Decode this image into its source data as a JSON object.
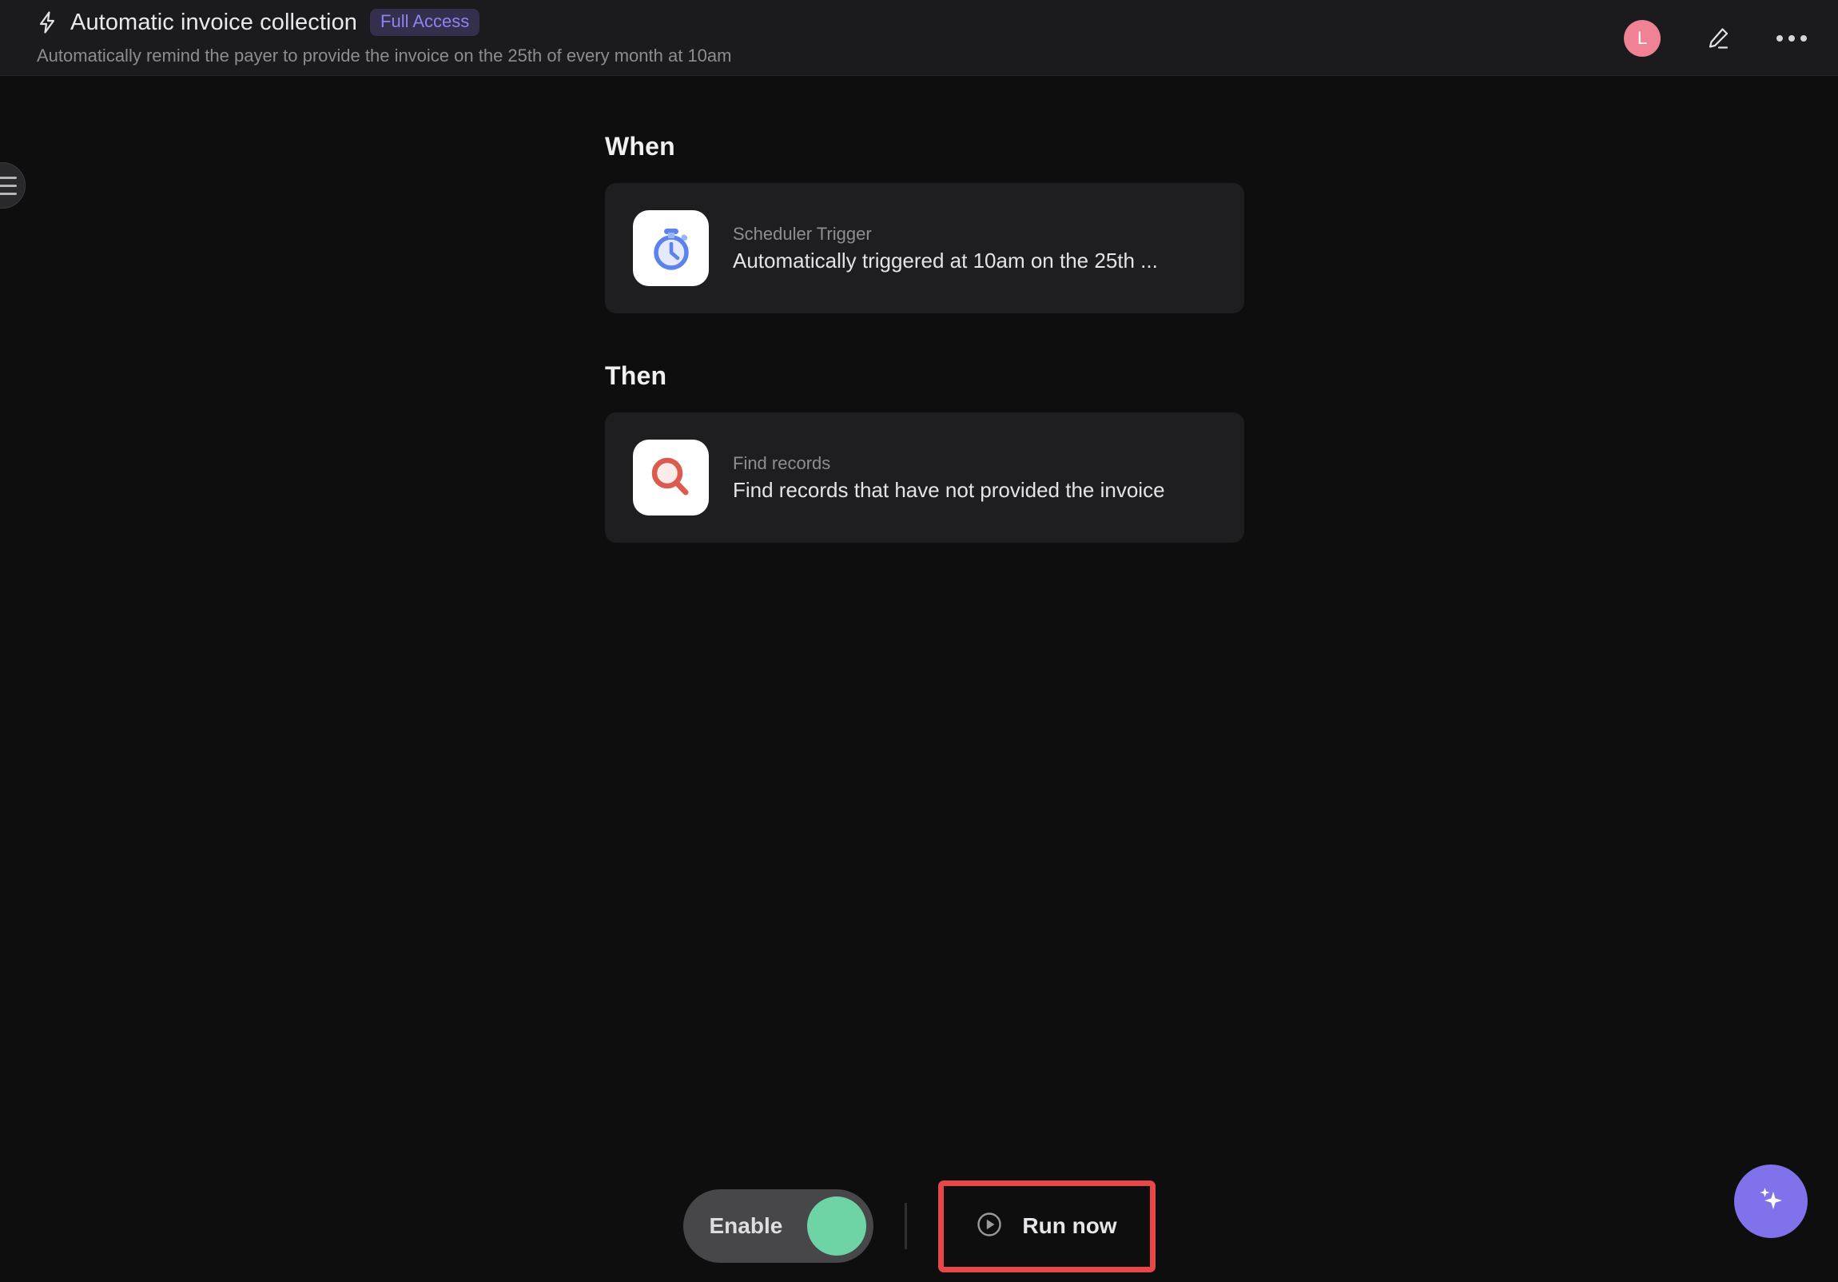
{
  "header": {
    "bolt_icon": "lightning-bolt-icon",
    "title": "Automatic invoice collection",
    "badge": "Full Access",
    "subtitle": "Automatically remind the payer to provide the invoice on the 25th of every month at 10am",
    "avatar_initial": "L",
    "avatar_color": "#ef8295",
    "edit_icon": "pencil-edit-icon",
    "more_icon": "more-options-icon"
  },
  "sidebar": {
    "toggle_icon": "hamburger-menu-icon"
  },
  "flow": {
    "when": {
      "label": "When",
      "icon": "scheduler-stopwatch-icon",
      "kicker": "Scheduler Trigger",
      "description": "Automatically triggered at 10am on the 25th ..."
    },
    "then": {
      "label": "Then",
      "icon": "find-records-magnifier-icon",
      "kicker": "Find records",
      "description": "Find records that have not provided the invoice"
    }
  },
  "actions": {
    "enable_label": "Enable",
    "enable_state": "on",
    "enable_knob_color": "#6ed4a5",
    "run_icon": "play-circle-icon",
    "run_label": "Run now",
    "highlight_color": "#e8474a"
  },
  "fab": {
    "icon": "ai-sparkle-icon",
    "color": "#7f72ea"
  },
  "colors": {
    "page_background": "#0e0e0f",
    "header_background": "#1b1b1d",
    "card_background": "#1e1e20",
    "badge_background": "#342f4c",
    "badge_text": "#8e83ef"
  }
}
